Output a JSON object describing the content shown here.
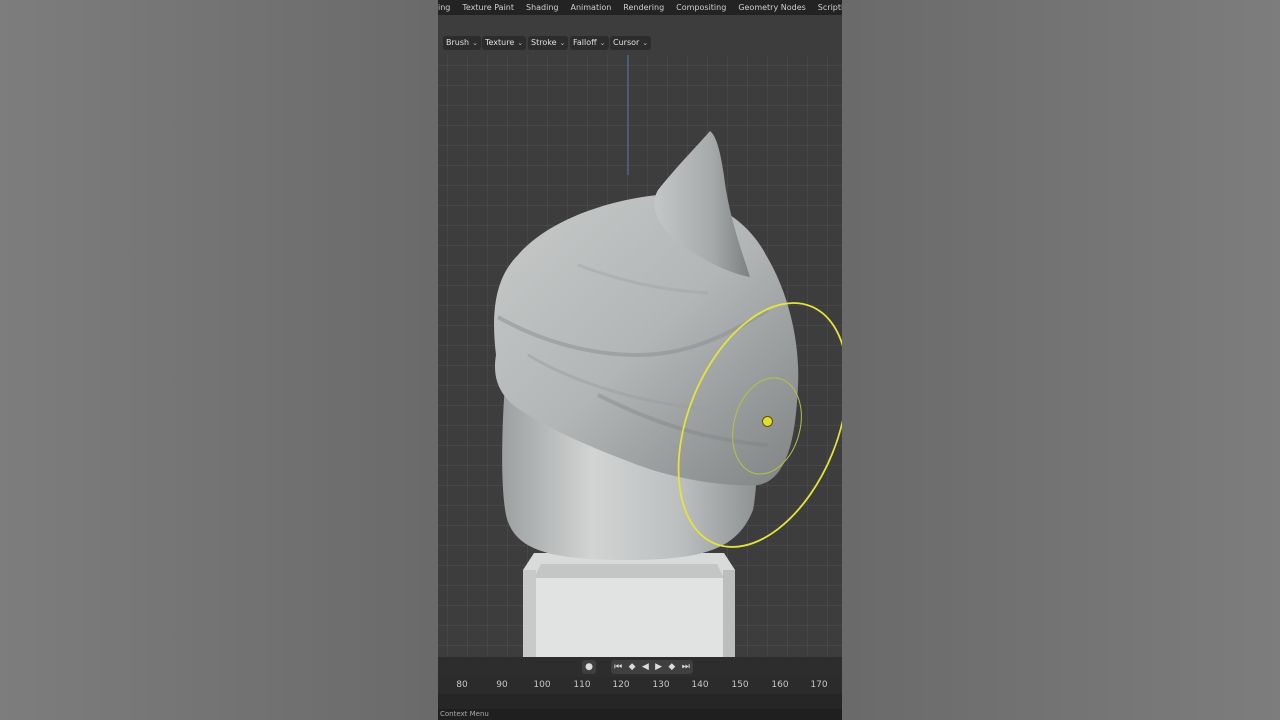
{
  "topbar": {
    "workspaces": [
      "ing",
      "Texture Paint",
      "Shading",
      "Animation",
      "Rendering",
      "Compositing",
      "Geometry Nodes",
      "Scripting"
    ],
    "add_label": "+"
  },
  "header": {
    "menus": [
      "Brush",
      "Texture",
      "Stroke",
      "Falloff",
      "Cursor"
    ]
  },
  "timeline": {
    "frames": [
      "80",
      "90",
      "100",
      "110",
      "120",
      "130",
      "140",
      "150",
      "160",
      "170"
    ]
  },
  "status": {
    "hint": "Context Menu"
  },
  "colors": {
    "brush_circle": "#e4e43a",
    "background": "#3d3d3d"
  }
}
